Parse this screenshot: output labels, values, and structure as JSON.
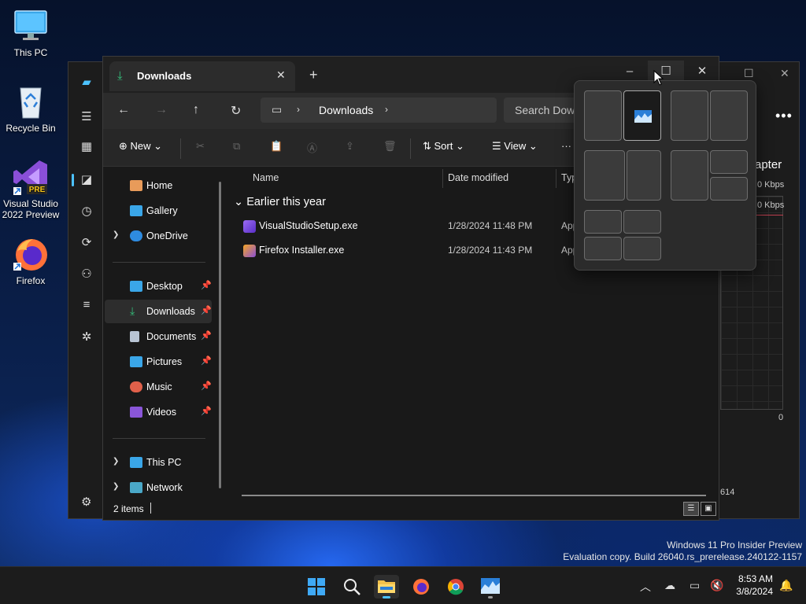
{
  "desktop": {
    "icons": [
      {
        "label": "This PC"
      },
      {
        "label": "Recycle Bin"
      },
      {
        "label": "Visual Studio 2022 Preview",
        "badge": "PRE"
      },
      {
        "label": "Firefox"
      }
    ]
  },
  "background_window": {
    "partial_title": "apter",
    "speed_1": "0 Kbps",
    "speed_2": "0 Kbps",
    "axis_zero": "0",
    "partial_ip": "614"
  },
  "explorer": {
    "tab_title": "Downloads",
    "new_tab_icon": "plus-icon",
    "breadcrumb_location": "Downloads",
    "search_placeholder": "Search Downloads",
    "toolbar": {
      "new_label": "New",
      "sort_label": "Sort",
      "view_label": "View",
      "more_label": "···"
    },
    "nav": {
      "home": "Home",
      "gallery": "Gallery",
      "onedrive": "OneDrive",
      "desktop": "Desktop",
      "downloads": "Downloads",
      "documents": "Documents",
      "pictures": "Pictures",
      "music": "Music",
      "videos": "Videos",
      "thispc": "This PC",
      "network": "Network"
    },
    "columns": {
      "name": "Name",
      "date": "Date modified",
      "type": "Type"
    },
    "group_label": "Earlier this year",
    "files": [
      {
        "name": "VisualStudioSetup.exe",
        "date": "1/28/2024 11:48 PM",
        "type": "Application"
      },
      {
        "name": "Firefox Installer.exe",
        "date": "1/28/2024 11:43 PM",
        "type": "Application"
      }
    ],
    "status_count": "2 items"
  },
  "watermark": {
    "line1": "Windows 11 Pro Insider Preview",
    "line2": "Evaluation copy. Build 26040.rs_prerelease.240122-1157"
  },
  "taskbar": {
    "time": "8:53 AM",
    "date": "3/8/2024"
  },
  "colors": {
    "accent": "#4cc2ff",
    "downloads_green": "#35c07c",
    "window_bg": "#191919",
    "taskbar_bg": "#1c1c1c"
  }
}
